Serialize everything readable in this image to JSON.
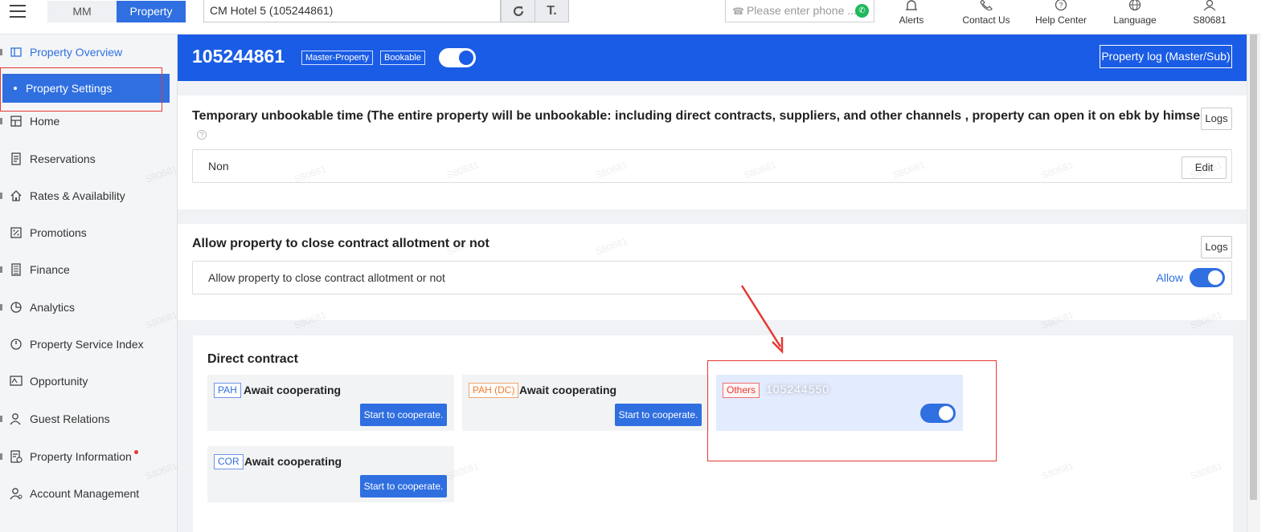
{
  "topbar": {
    "tabs": [
      {
        "label": "MM",
        "active": false
      },
      {
        "label": "Property",
        "active": true
      }
    ],
    "hotel_selector": "CM Hotel 5 (105244861)",
    "phone_placeholder": "Please enter phone ...",
    "nav": [
      {
        "label": "Alerts",
        "icon": "bell-icon"
      },
      {
        "label": "Contact Us",
        "icon": "phone-icon"
      },
      {
        "label": "Help Center",
        "icon": "help-icon"
      },
      {
        "label": "Language",
        "icon": "globe-icon"
      },
      {
        "label": "S80681",
        "icon": "user-icon"
      }
    ]
  },
  "sidebar": {
    "items": [
      {
        "label": "Property Overview",
        "icon": "property-icon"
      },
      {
        "label": "Property Settings"
      },
      {
        "label": "Home",
        "icon": "home-icon"
      },
      {
        "label": "Reservations",
        "icon": "document-icon"
      },
      {
        "label": "Rates & Availability",
        "icon": "house-icon"
      },
      {
        "label": "Promotions",
        "icon": "percent-icon"
      },
      {
        "label": "Finance",
        "icon": "ledger-icon"
      },
      {
        "label": "Analytics",
        "icon": "pie-chart-icon"
      },
      {
        "label": "Property Service Index",
        "icon": "gauge-icon"
      },
      {
        "label": "Opportunity",
        "icon": "opportunity-icon"
      },
      {
        "label": "Guest Relations",
        "icon": "user-icon"
      },
      {
        "label": "Property Information",
        "icon": "info-doc-icon"
      },
      {
        "label": "Account Management",
        "icon": "account-icon"
      }
    ]
  },
  "header": {
    "property_id": "105244861",
    "tags": [
      "Master-Property",
      "Bookable"
    ],
    "log_button": "Property log (Master/Sub)",
    "bookable_on": true
  },
  "unbookable": {
    "title": "Temporary unbookable time (The entire property will be unbookable: including direct contracts, suppliers, and other channels , property can open it on ebk by himself)",
    "logs": "Logs",
    "value": "Non",
    "edit": "Edit"
  },
  "allotment": {
    "title": "Allow property to close contract allotment or not",
    "logs": "Logs",
    "row_label": "Allow property to close contract allotment or not",
    "allow_label": "Allow",
    "allow_on": true
  },
  "direct_contract": {
    "title": "Direct contract",
    "tiles": [
      {
        "tag": "PAH",
        "status": "Await cooperating",
        "button": "Start to cooperate."
      },
      {
        "tag": "PAH (DC)",
        "status": "Await cooperating",
        "button": "Start to cooperate."
      },
      {
        "tag": "Others",
        "status": "105244550"
      },
      {
        "tag": "COR",
        "status": "Await cooperating",
        "button": "Start to cooperate."
      }
    ],
    "others_on": true
  },
  "watermark": "S80681",
  "colors": {
    "accent": "#2f6fe0",
    "header": "#1a5ce5",
    "annotation": "#e53935"
  }
}
